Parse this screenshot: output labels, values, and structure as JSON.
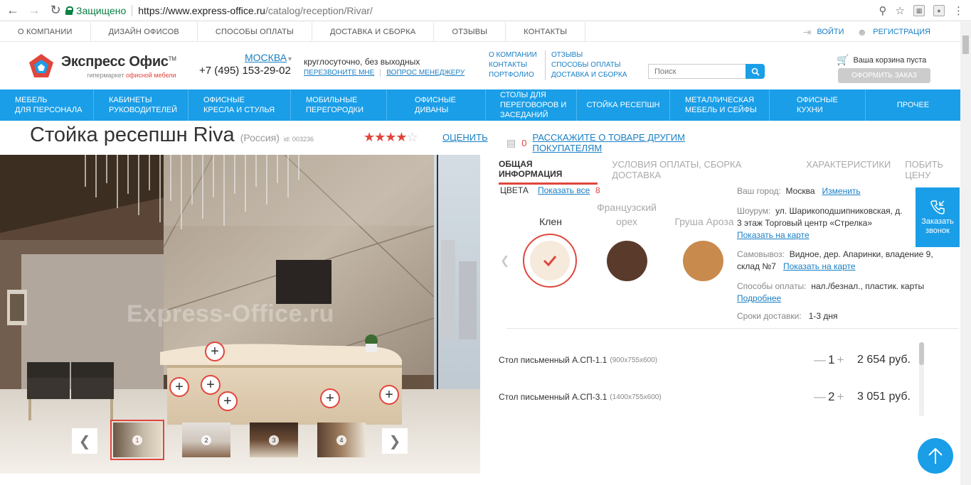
{
  "browser": {
    "secure_label": "Защищено",
    "url_host": "https://www.express-office.ru",
    "url_path": "/catalog/reception/Rivar/"
  },
  "topbar": {
    "links": [
      "О КОМПАНИИ",
      "ДИЗАЙН ОФИСОВ",
      "СПОСОБЫ ОПЛАТЫ",
      "ДОСТАВКА И СБОРКА",
      "ОТЗЫВЫ",
      "КОНТАКТЫ"
    ],
    "login": "ВОЙТИ",
    "register": "РЕГИСТРАЦИЯ"
  },
  "header": {
    "logo_name": "Экспресс Офис",
    "logo_tm": "TM",
    "logo_sub_a": "гипермаркет ",
    "logo_sub_b": "офисной мебели",
    "city": "МОСКВА",
    "phone": "+7 (495) 153-29-02",
    "hours": "круглосуточно, без выходных",
    "callback_link": "ПЕРЕЗВОНИТЕ МНЕ",
    "question_link": "ВОПРОС МЕНЕДЖЕРУ",
    "col1": [
      "О КОМПАНИИ",
      "КОНТАКТЫ",
      "ПОРТФОЛИО"
    ],
    "col2": [
      "ОТЗЫВЫ",
      "СПОСОБЫ ОПЛАТЫ",
      "ДОСТАВКА И СБОРКА"
    ],
    "search_placeholder": "Поиск",
    "cart_text": "Ваша корзина пуста",
    "order_button": "ОФОРМИТЬ ЗАКАЗ"
  },
  "categories": [
    {
      "l1": "МЕБЕЛЬ",
      "l2": "ДЛЯ ПЕРСОНАЛА",
      "l3": ""
    },
    {
      "l1": "КАБИНЕТЫ",
      "l2": "РУКОВОДИТЕЛЕЙ",
      "l3": ""
    },
    {
      "l1": "ОФИСНЫЕ",
      "l2": "КРЕСЛА И СТУЛЬЯ",
      "l3": ""
    },
    {
      "l1": "МОБИЛЬНЫЕ",
      "l2": "ПЕРЕГОРОДКИ",
      "l3": ""
    },
    {
      "l1": "ОФИСНЫЕ",
      "l2": "ДИВАНЫ",
      "l3": ""
    },
    {
      "l1": "СТОЛЫ ДЛЯ",
      "l2": "ПЕРЕГОВОРОВ И",
      "l3": "ЗАСЕДАНИЙ"
    },
    {
      "l1": "СТОЙКА РЕСЕПШН",
      "l2": "",
      "l3": ""
    },
    {
      "l1": "МЕТАЛЛИЧЕСКАЯ",
      "l2": "МЕБЕЛЬ И СЕЙФЫ",
      "l3": ""
    },
    {
      "l1": "ОФИСНЫЕ",
      "l2": "КУХНИ",
      "l3": ""
    },
    {
      "l1": "ПРОЧЕЕ",
      "l2": "",
      "l3": ""
    }
  ],
  "product": {
    "title": "Стойка ресепшн Riva",
    "country": "(Россия)",
    "id": "id: 003236",
    "rating": 4,
    "rating_max": 5,
    "rate_link": "ОЦЕНИТЬ",
    "reviews_count": "0",
    "reviews_link": "РАССКАЖИТЕ О ТОВАРЕ ДРУГИМ ПОКУПАТЕЛЯМ",
    "watermark": "Express-Office.ru",
    "thumbs": [
      "1",
      "2",
      "3",
      "4"
    ]
  },
  "tabs": [
    "ОБЩАЯ ИНФОРМАЦИЯ",
    "УСЛОВИЯ ОПЛАТЫ, СБОРКА ДОСТАВКА",
    "ХАРАКТЕРИСТИКИ",
    "ПОБИТЬ ЦЕНУ"
  ],
  "colors": {
    "label": "ЦВЕТА",
    "show_all": "Показать все",
    "count": "8",
    "items": [
      {
        "name": "Клен",
        "name2": "",
        "hex": "#f6eadc",
        "selected": true
      },
      {
        "name": "Французский",
        "name2": "орех",
        "hex": "#5a3a2a",
        "selected": false
      },
      {
        "name": "Груша Ароза",
        "name2": "",
        "hex": "#c98a4e",
        "selected": false
      }
    ]
  },
  "info": {
    "city_label": "Ваш город:",
    "city_value": "Москва",
    "city_change": "Изменить",
    "showroom_label": "Шоурум:",
    "showroom_line1": "ул. Шарикоподшипниковская, д.",
    "showroom_line2": "3 этаж Торговый центр «Стрелка»",
    "showroom_map": "Показать на карте",
    "pickup_label": "Самовывоз:",
    "pickup_line1": "Видное, дер. Апаринки, владение 9,",
    "pickup_line2": "склад №7",
    "pickup_map": "Показать на карте",
    "pay_label": "Способы оплаты:",
    "pay_value": "нал./безнал., пластик. карты",
    "pay_more": "Подробнее",
    "delivery_label": "Сроки доставки:",
    "delivery_value": "1-3 дня"
  },
  "items": [
    {
      "name": "Стол письменный А.СП-1.1",
      "size": "(900х755х600)",
      "qty": "1",
      "price": "2 654 руб."
    },
    {
      "name": "Стол письменный А.СП-3.1",
      "size": "(1400х755х600)",
      "qty": "2",
      "price": "3 051 руб."
    }
  ],
  "callback_btn": {
    "l1": "Заказать",
    "l2": "звонок"
  },
  "colors_theme": {
    "accent": "#1a9ee8",
    "red": "#e0463c",
    "link": "#1a7fc4"
  }
}
